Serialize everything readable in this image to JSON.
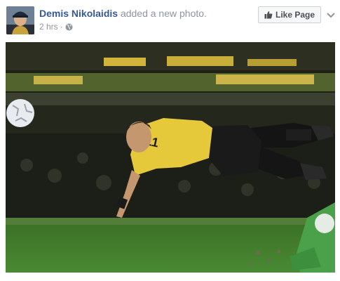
{
  "post": {
    "author": "Demis Nikolaidis",
    "action": "added a new photo.",
    "timestamp": "2 hrs",
    "separator": "·",
    "privacy_icon": "globe-icon",
    "like_page_label": "Like Page",
    "like_icon": "thumbs-up-icon",
    "menu_icon": "chevron-down-icon",
    "photo_subject": "football-diving-header-photo"
  },
  "colors": {
    "author_link": "#365899",
    "secondary_text": "#90949c",
    "button_bg": "#f6f7f9",
    "button_border": "#ced0d4",
    "jersey_yellow": "#e6c93a",
    "pitch_green": "#3f7a2a"
  }
}
